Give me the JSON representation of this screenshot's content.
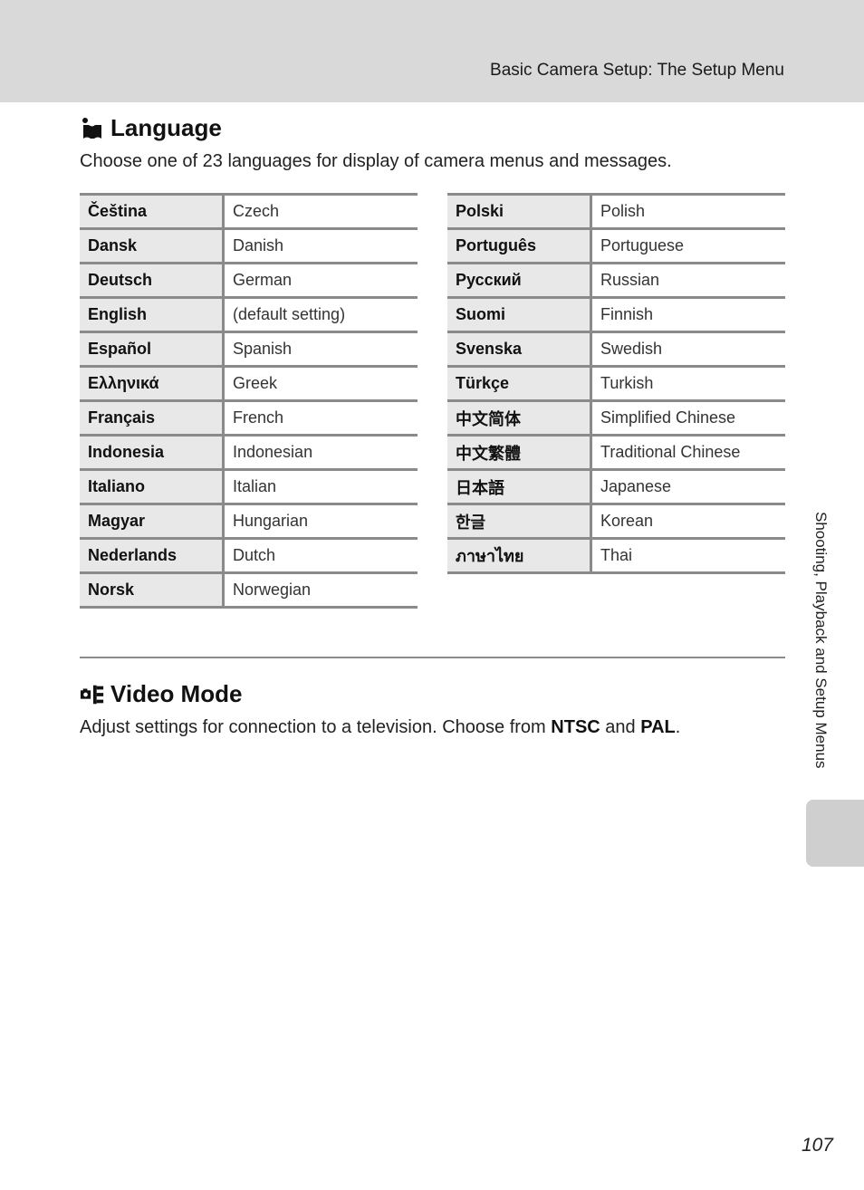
{
  "header": {
    "running_head": "Basic Camera Setup: The Setup Menu"
  },
  "language_section": {
    "icon": "language-setting-icon",
    "title": "Language",
    "description": "Choose one of 23 languages for display of camera menus and messages.",
    "left_table": [
      {
        "native": "Čeština",
        "english": "Czech"
      },
      {
        "native": "Dansk",
        "english": "Danish"
      },
      {
        "native": "Deutsch",
        "english": "German"
      },
      {
        "native": "English",
        "english": "(default setting)"
      },
      {
        "native": "Español",
        "english": "Spanish"
      },
      {
        "native": "Ελληνικά",
        "english": "Greek"
      },
      {
        "native": "Français",
        "english": "French"
      },
      {
        "native": "Indonesia",
        "english": "Indonesian"
      },
      {
        "native": "Italiano",
        "english": "Italian"
      },
      {
        "native": "Magyar",
        "english": "Hungarian"
      },
      {
        "native": "Nederlands",
        "english": "Dutch"
      },
      {
        "native": "Norsk",
        "english": "Norwegian"
      }
    ],
    "right_table": [
      {
        "native": "Polski",
        "english": "Polish"
      },
      {
        "native": "Português",
        "english": "Portuguese"
      },
      {
        "native": "Русский",
        "english": "Russian"
      },
      {
        "native": "Suomi",
        "english": "Finnish"
      },
      {
        "native": "Svenska",
        "english": "Swedish"
      },
      {
        "native": "Türkçe",
        "english": "Turkish"
      },
      {
        "native": "中文简体",
        "english": "Simplified Chinese"
      },
      {
        "native": "中文繁體",
        "english": "Traditional Chinese"
      },
      {
        "native": "日本語",
        "english": "Japanese"
      },
      {
        "native": "한글",
        "english": "Korean"
      },
      {
        "native": "ภาษาไทย",
        "english": "Thai"
      }
    ]
  },
  "video_section": {
    "icon": "video-mode-icon",
    "title": "Video Mode",
    "description_pre": "Adjust settings for connection to a television. Choose from ",
    "option1": "NTSC",
    "description_mid": " and ",
    "option2": "PAL",
    "description_post": "."
  },
  "side_tab": {
    "label": "Shooting, Playback and Setup Menus"
  },
  "footer": {
    "page_number": "107"
  }
}
